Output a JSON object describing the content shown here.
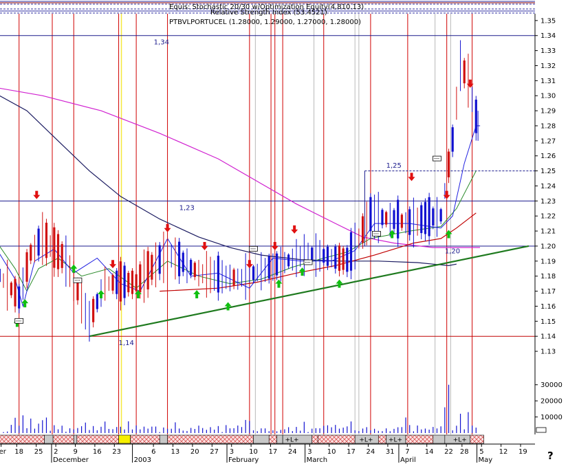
{
  "header": {
    "line1": "Equis: Stochastic 20/30 w/Optimization Equity(4,810.13)",
    "line2": "Relative Strength Index (53.4521)",
    "symbol": "PTBVLPORTUCEL (1.28000, 1.29000, 1.27000, 1.28000)"
  },
  "help_mark": "?",
  "chart_data": {
    "type": "candlestick",
    "title": "PTBVLPORTUCEL",
    "ohlc": {
      "open": 1.28,
      "high": 1.29,
      "low": 1.27,
      "close": 1.28
    },
    "y_ticks": [
      "1.35",
      "1.34",
      "1.33",
      "1.32",
      "1.31",
      "1.30",
      "1.29",
      "1.28",
      "1.27",
      "1.26",
      "1.25",
      "1.24",
      "1.23",
      "1.22",
      "1.21",
      "1.20",
      "1.19",
      "1.18",
      "1.17",
      "1.16",
      "1.15",
      "1.14",
      "1.13"
    ],
    "ylim": [
      1.125,
      1.36
    ],
    "volume_ticks": [
      "30000",
      "20000",
      "10000"
    ],
    "volume_ylim": [
      0,
      35000
    ],
    "x_day_labels": [
      {
        "t": "er",
        "d": -0.6
      },
      {
        "t": "18",
        "d": 3.4
      },
      {
        "t": "25",
        "d": 8.4
      },
      {
        "t": "2",
        "d": 13.4
      },
      {
        "t": "9",
        "d": 18.4
      },
      {
        "t": "16",
        "d": 23.4
      },
      {
        "t": "23",
        "d": 28.4
      },
      {
        "t": "6",
        "d": 38.4
      },
      {
        "t": "13",
        "d": 43.4
      },
      {
        "t": "20",
        "d": 48.4
      },
      {
        "t": "27",
        "d": 53.4
      },
      {
        "t": "3",
        "d": 58.4
      },
      {
        "t": "10",
        "d": 63.4
      },
      {
        "t": "17",
        "d": 68.4
      },
      {
        "t": "24",
        "d": 73.4
      },
      {
        "t": "3",
        "d": 78.4
      },
      {
        "t": "10",
        "d": 83.4
      },
      {
        "t": "17",
        "d": 88.4
      },
      {
        "t": "24",
        "d": 93.4
      },
      {
        "t": "31",
        "d": 98.4
      },
      {
        "t": "7",
        "d": 103.4
      },
      {
        "t": "14",
        "d": 108.4
      },
      {
        "t": "22",
        "d": 113.4
      },
      {
        "t": "28",
        "d": 117.4
      },
      {
        "t": "5",
        "d": 122.4
      },
      {
        "t": "12",
        "d": 127.4
      },
      {
        "t": "19",
        "d": 132.4
      }
    ],
    "x_month_labels": [
      {
        "t": "December",
        "d": 12.5
      },
      {
        "t": "2003",
        "d": 33.2
      },
      {
        "t": "February",
        "d": 57.4
      },
      {
        "t": "March",
        "d": 77.4
      },
      {
        "t": "April",
        "d": 101.4
      },
      {
        "t": "May",
        "d": 121.4
      }
    ],
    "h_levels": [
      1.34,
      1.23,
      1.2,
      1.14
    ],
    "level_labels": [
      {
        "t": "1,34",
        "d": 38.5,
        "y": 1.335
      },
      {
        "t": "1,23",
        "d": 45.0,
        "y": 1.225
      },
      {
        "t": "1,25",
        "d": 98.0,
        "y": 1.253
      },
      {
        "t": "1,20",
        "d": 113.0,
        "y": 1.196
      },
      {
        "t": "1,14",
        "d": 29.5,
        "y": 1.135
      }
    ],
    "resistance_dashed": {
      "x_from_d": 92.5,
      "y": 1.25
    },
    "support_trend": {
      "from": {
        "d": 22.0,
        "y": 1.14
      },
      "to": {
        "d": 134.5,
        "y": 1.2
      }
    },
    "red_vlines": [
      4,
      12.5,
      18,
      29.5,
      34,
      42,
      63,
      68.5,
      69.5,
      71.5,
      82,
      94,
      103.5,
      113.5,
      120
    ],
    "gray_vlines": [
      64.5,
      79.5,
      90,
      91,
      110.5,
      114.5
    ],
    "yellow_vline": 30.2,
    "buy_arrows": [
      {
        "d": 3.5,
        "y": 1.149
      },
      {
        "d": 5.5,
        "y": 1.162
      },
      {
        "d": 18.0,
        "y": 1.185
      },
      {
        "d": 25.0,
        "y": 1.168
      },
      {
        "d": 34.5,
        "y": 1.168
      },
      {
        "d": 49.5,
        "y": 1.168
      },
      {
        "d": 57.5,
        "y": 1.16
      },
      {
        "d": 70.5,
        "y": 1.175
      },
      {
        "d": 76.5,
        "y": 1.183
      },
      {
        "d": 86.0,
        "y": 1.175
      },
      {
        "d": 99.5,
        "y": 1.208
      },
      {
        "d": 114.0,
        "y": 1.208
      }
    ],
    "sell_arrows": [
      {
        "d": 8.5,
        "y": 1.234
      },
      {
        "d": 28.0,
        "y": 1.188
      },
      {
        "d": 42.0,
        "y": 1.212
      },
      {
        "d": 51.5,
        "y": 1.2
      },
      {
        "d": 63.0,
        "y": 1.188
      },
      {
        "d": 69.5,
        "y": 1.2
      },
      {
        "d": 74.5,
        "y": 1.211
      },
      {
        "d": 104.5,
        "y": 1.246
      },
      {
        "d": 113.5,
        "y": 1.234
      },
      {
        "d": 119.5,
        "y": 1.308
      }
    ],
    "exit_markers": [
      {
        "d": 4.0,
        "y": 1.15
      },
      {
        "d": 19.0,
        "y": 1.177
      },
      {
        "d": 64.0,
        "y": 1.198
      },
      {
        "d": 78.0,
        "y": 1.189
      },
      {
        "d": 95.5,
        "y": 1.208
      },
      {
        "d": 111.0,
        "y": 1.258
      }
    ],
    "band_labels": [
      {
        "t": "+L+",
        "d": 73.5
      },
      {
        "t": "+L+",
        "d": 92.5
      },
      {
        "t": "+L+",
        "d": 100.0
      },
      {
        "t": "+L+",
        "d": 116.5
      }
    ]
  }
}
